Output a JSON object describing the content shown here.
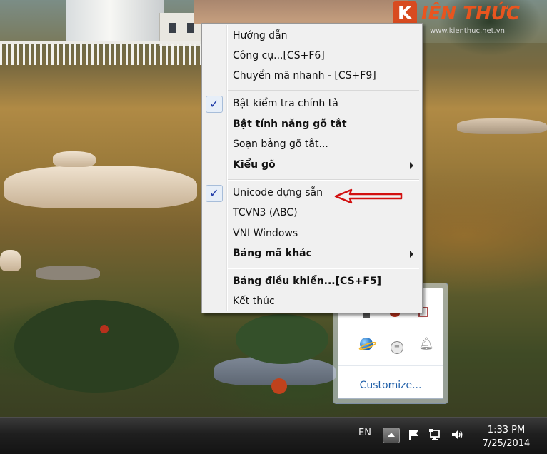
{
  "watermark": {
    "logo_text": "IÊN THỨC",
    "logo_mark": "K",
    "url": "www.kienthuc.net.vn"
  },
  "context_menu": {
    "items": [
      {
        "label": "Hướng dẫn",
        "checked": false,
        "bold": false,
        "submenu": false
      },
      {
        "label": "Công cụ...[CS+F6]",
        "checked": false,
        "bold": false,
        "submenu": false
      },
      {
        "label": "Chuyển mã nhanh - [CS+F9]",
        "checked": false,
        "bold": false,
        "submenu": false
      },
      {
        "label": "Bật kiểm tra chính tả",
        "checked": true,
        "bold": false,
        "submenu": false
      },
      {
        "label": "Bật tính năng gõ tắt",
        "checked": false,
        "bold": true,
        "submenu": false
      },
      {
        "label": "Soạn bảng gõ tắt...",
        "checked": false,
        "bold": false,
        "submenu": false
      },
      {
        "label": "Kiểu gõ",
        "checked": false,
        "bold": true,
        "submenu": true
      },
      {
        "label": "Unicode dựng sẵn",
        "checked": true,
        "bold": false,
        "submenu": false
      },
      {
        "label": "TCVN3 (ABC)",
        "checked": false,
        "bold": false,
        "submenu": false
      },
      {
        "label": "VNI Windows",
        "checked": false,
        "bold": false,
        "submenu": false
      },
      {
        "label": "Bảng mã khác",
        "checked": false,
        "bold": false,
        "submenu": true
      },
      {
        "label": "Bảng điều khiển...[CS+F5]",
        "checked": false,
        "bold": true,
        "submenu": false
      },
      {
        "label": "Kết thúc",
        "checked": false,
        "bold": false,
        "submenu": false
      }
    ],
    "check_glyph": "✓",
    "annotation_color": "#d21010"
  },
  "tray_flyout": {
    "icons": [
      "internet-explorer-icon",
      "messenger-icon",
      "action-center-bell-icon"
    ],
    "customize_label": "Customize..."
  },
  "taskbar": {
    "language": "EN",
    "time": "1:33 PM",
    "date": "7/25/2014",
    "icons": [
      "show-hidden-icons-button",
      "flag-icon",
      "network-icon",
      "volume-icon"
    ]
  }
}
